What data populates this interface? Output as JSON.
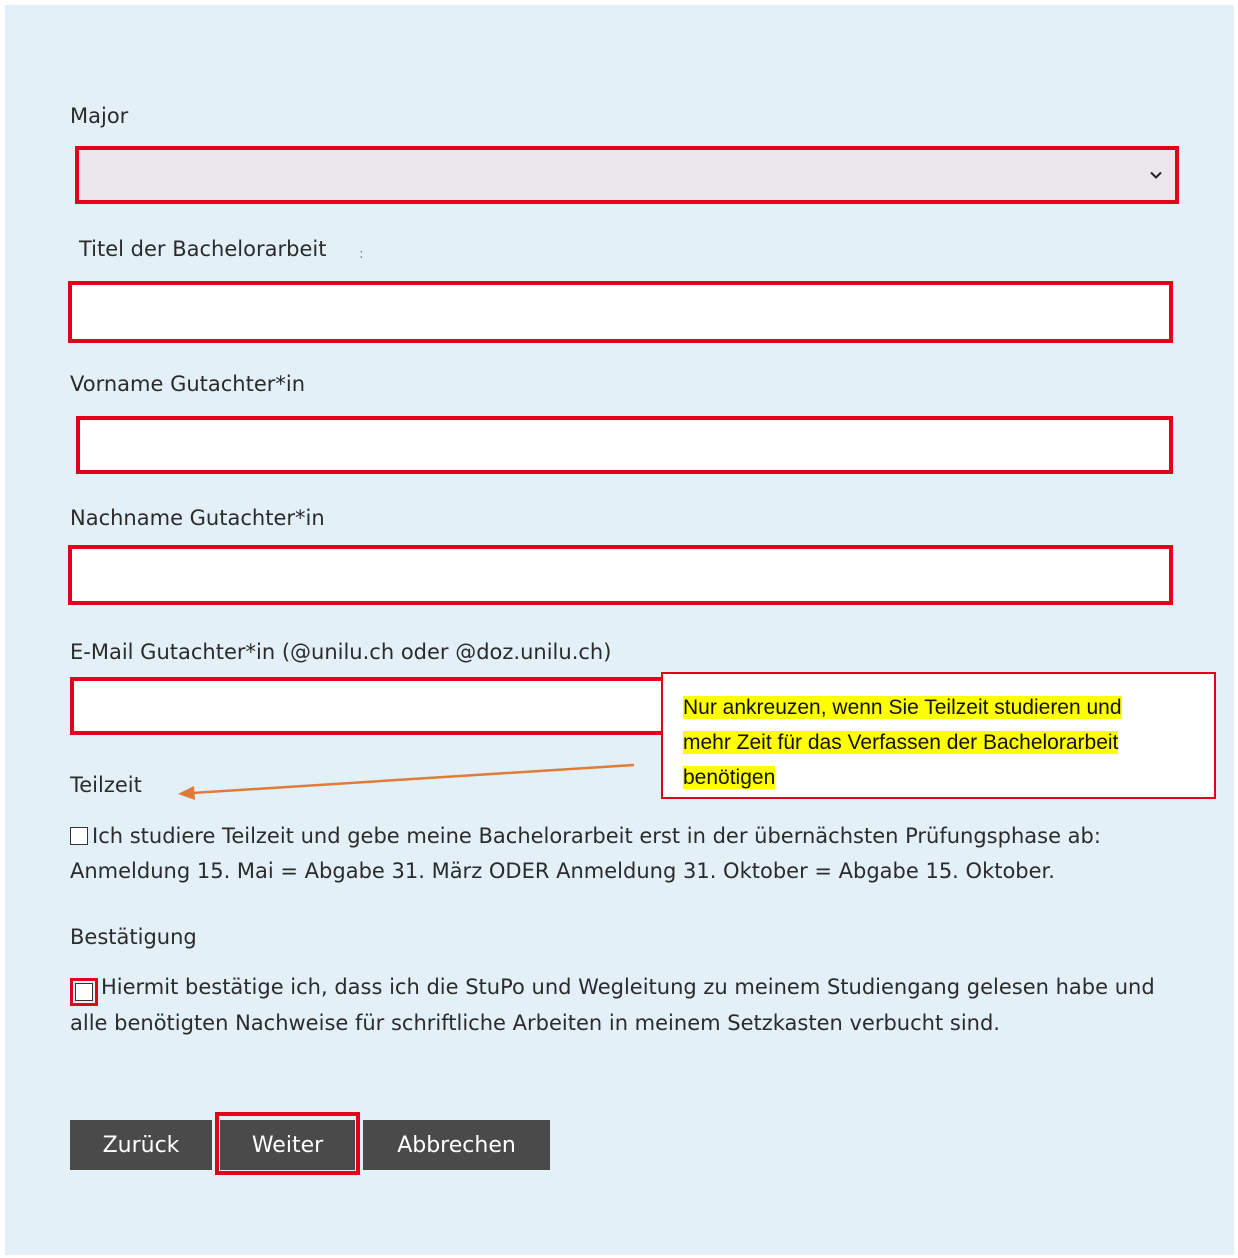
{
  "form": {
    "major_label": "Major",
    "major_value": "",
    "title_label": "Titel der Bachelorarbeit",
    "title_suffix": ":",
    "title_value": "",
    "reviewer_firstname_label": "Vorname Gutachter*in",
    "reviewer_firstname_value": "",
    "reviewer_lastname_label": "Nachname Gutachter*in",
    "reviewer_lastname_value": "",
    "reviewer_email_label": "E-Mail Gutachter*in (@unilu.ch oder @doz.unilu.ch)",
    "reviewer_email_value": "",
    "parttime_label": "Teilzeit",
    "parttime_checked": false,
    "parttime_text": "Ich studiere Teilzeit und gebe meine Bachelorarbeit erst in der übernächsten Prüfungsphase ab: Anmeldung 15. Mai = Abgabe 31. März ODER Anmeldung 31. Oktober = Abgabe 15. Oktober.",
    "confirm_label": "Bestätigung",
    "confirm_checked": false,
    "confirm_text": "Hiermit bestätige ich, dass ich die StuPo und Wegleitung zu meinem Studiengang gelesen habe und alle benötigten Nachweise für schriftliche Arbeiten in meinem Setzkasten verbucht sind."
  },
  "callout": {
    "line1": "Nur ankreuzen, wenn Sie Teilzeit studieren und",
    "line2": "mehr Zeit für das Verfassen der Bachelorarbeit",
    "line3": "benötigen"
  },
  "buttons": {
    "back": "Zurück",
    "next": "Weiter",
    "cancel": "Abbrechen"
  },
  "colors": {
    "highlight": "#e2001a",
    "arrow": "#e07b39",
    "panel": "#e3f0f8",
    "button": "#4a4a4a",
    "marker": "#ffff00"
  },
  "icons": {
    "select": "chevron-down-icon",
    "pointer": "arrow-left-icon"
  }
}
